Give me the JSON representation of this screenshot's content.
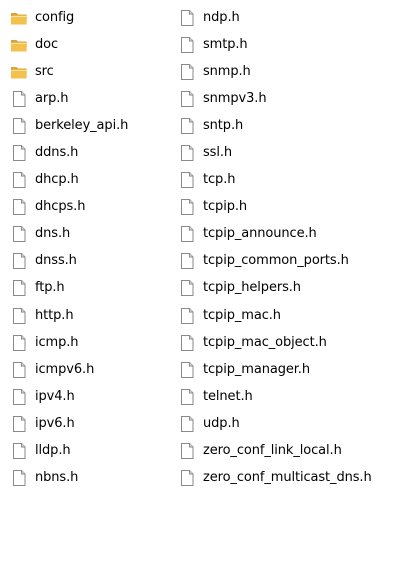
{
  "columns": [
    {
      "items": [
        {
          "name": "config",
          "type": "folder"
        },
        {
          "name": "doc",
          "type": "folder"
        },
        {
          "name": "src",
          "type": "folder"
        },
        {
          "name": "arp.h",
          "type": "file"
        },
        {
          "name": "berkeley_api.h",
          "type": "file"
        },
        {
          "name": "ddns.h",
          "type": "file"
        },
        {
          "name": "dhcp.h",
          "type": "file"
        },
        {
          "name": "dhcps.h",
          "type": "file"
        },
        {
          "name": "dns.h",
          "type": "file"
        },
        {
          "name": "dnss.h",
          "type": "file"
        },
        {
          "name": "ftp.h",
          "type": "file"
        },
        {
          "name": "http.h",
          "type": "file"
        },
        {
          "name": "icmp.h",
          "type": "file"
        },
        {
          "name": "icmpv6.h",
          "type": "file"
        },
        {
          "name": "ipv4.h",
          "type": "file"
        },
        {
          "name": "ipv6.h",
          "type": "file"
        },
        {
          "name": "lldp.h",
          "type": "file"
        },
        {
          "name": "nbns.h",
          "type": "file"
        }
      ]
    },
    {
      "items": [
        {
          "name": "ndp.h",
          "type": "file"
        },
        {
          "name": "smtp.h",
          "type": "file"
        },
        {
          "name": "snmp.h",
          "type": "file"
        },
        {
          "name": "snmpv3.h",
          "type": "file"
        },
        {
          "name": "sntp.h",
          "type": "file"
        },
        {
          "name": "ssl.h",
          "type": "file"
        },
        {
          "name": "tcp.h",
          "type": "file"
        },
        {
          "name": "tcpip.h",
          "type": "file"
        },
        {
          "name": "tcpip_announce.h",
          "type": "file"
        },
        {
          "name": "tcpip_common_ports.h",
          "type": "file"
        },
        {
          "name": "tcpip_helpers.h",
          "type": "file"
        },
        {
          "name": "tcpip_mac.h",
          "type": "file"
        },
        {
          "name": "tcpip_mac_object.h",
          "type": "file"
        },
        {
          "name": "tcpip_manager.h",
          "type": "file"
        },
        {
          "name": "telnet.h",
          "type": "file"
        },
        {
          "name": "udp.h",
          "type": "file"
        },
        {
          "name": "zero_conf_link_local.h",
          "type": "file"
        },
        {
          "name": "zero_conf_multicast_dns.h",
          "type": "file"
        }
      ]
    }
  ],
  "icons": {
    "folder": "folder-icon",
    "file": "file-icon"
  },
  "colors": {
    "folder_front": "#f2c14e",
    "folder_back": "#d9a53a",
    "file_fill": "#ffffff",
    "file_border": "#8a8a8a",
    "file_fold": "#d8d8d8"
  }
}
